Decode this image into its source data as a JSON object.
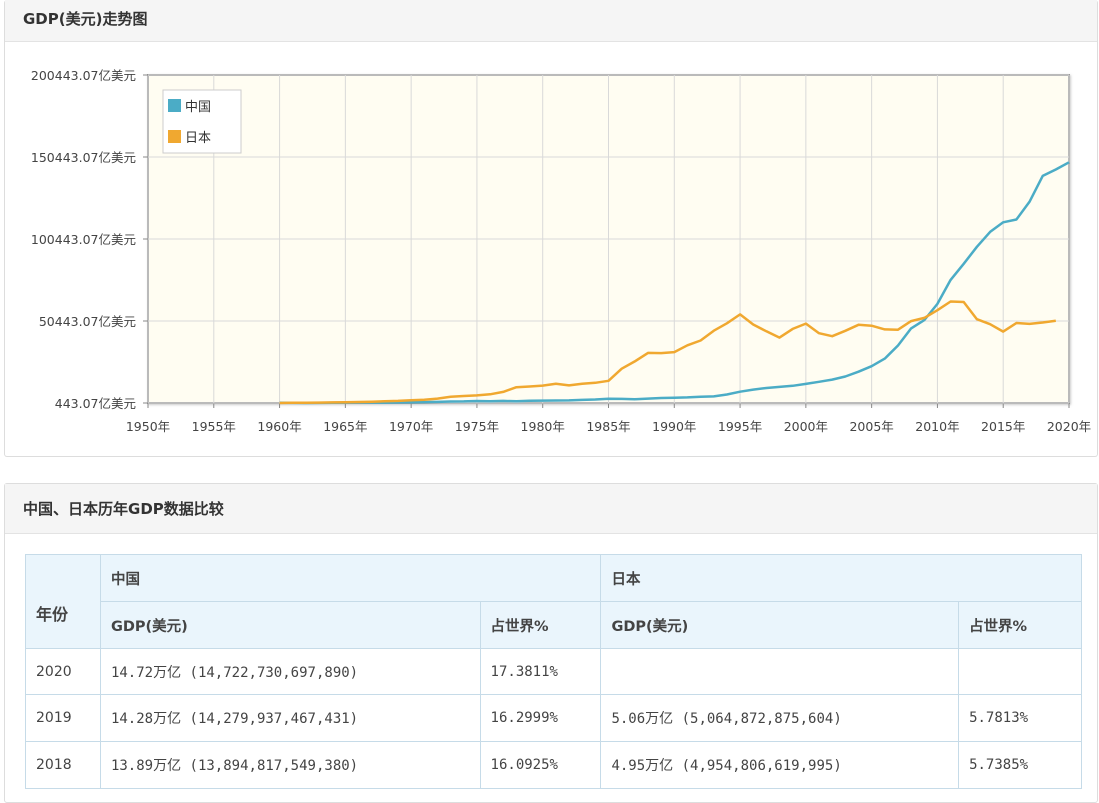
{
  "chart_panel": {
    "title": "GDP(美元)走势图"
  },
  "chart_data": {
    "type": "line",
    "title": "GDP(美元)走势图",
    "x_ticks": [
      "1950年",
      "1955年",
      "1960年",
      "1965年",
      "1970年",
      "1975年",
      "1980年",
      "1985年",
      "1990年",
      "1995年",
      "2000年",
      "2005年",
      "2010年",
      "2015年",
      "2020年"
    ],
    "y_ticks": [
      "443.07亿美元",
      "50443.07亿美元",
      "100443.07亿美元",
      "150443.07亿美元",
      "200443.07亿美元"
    ],
    "ylim": [
      443.07,
      200443.07
    ],
    "xlim": [
      1950,
      2020
    ],
    "grid": true,
    "legend_position": "top-left",
    "series": [
      {
        "name": "中国",
        "color": "#4bacc6",
        "x": [
          1960,
          1961,
          1962,
          1963,
          1964,
          1965,
          1966,
          1967,
          1968,
          1969,
          1970,
          1971,
          1972,
          1973,
          1974,
          1975,
          1976,
          1977,
          1978,
          1979,
          1980,
          1981,
          1982,
          1983,
          1984,
          1985,
          1986,
          1987,
          1988,
          1989,
          1990,
          1991,
          1992,
          1993,
          1994,
          1995,
          1996,
          1997,
          1998,
          1999,
          2000,
          2001,
          2002,
          2003,
          2004,
          2005,
          2006,
          2007,
          2008,
          2009,
          2010,
          2011,
          2012,
          2013,
          2014,
          2015,
          2016,
          2017,
          2018,
          2019,
          2020
        ],
        "values": [
          597,
          500,
          472,
          507,
          593,
          704,
          767,
          727,
          707,
          797,
          926,
          998,
          1137,
          1386,
          1442,
          1634,
          1539,
          1750,
          1495,
          1783,
          1911,
          1958,
          2050,
          2306,
          2599,
          3094,
          2970,
          2730,
          3123,
          3478,
          3609,
          3834,
          4269,
          4447,
          5643,
          7340,
          8637,
          9616,
          10290,
          10940,
          12110,
          13390,
          14710,
          16600,
          19550,
          22860,
          27530,
          35520,
          45940,
          51020,
          60870,
          75510,
          85320,
          95700,
          104750,
          110620,
          112330,
          123100,
          138948,
          142799,
          147227
        ]
      },
      {
        "name": "日本",
        "color": "#f0a830",
        "x": [
          1960,
          1961,
          1962,
          1963,
          1964,
          1965,
          1966,
          1967,
          1968,
          1969,
          1970,
          1971,
          1972,
          1973,
          1974,
          1975,
          1976,
          1977,
          1978,
          1979,
          1980,
          1981,
          1982,
          1983,
          1984,
          1985,
          1986,
          1987,
          1988,
          1989,
          1990,
          1991,
          1992,
          1993,
          1994,
          1995,
          1996,
          1997,
          1998,
          1999,
          2000,
          2001,
          2002,
          2003,
          2004,
          2005,
          2006,
          2007,
          2008,
          2009,
          2010,
          2011,
          2012,
          2013,
          2014,
          2015,
          2016,
          2017,
          2018,
          2019
        ],
        "values": [
          443,
          536,
          609,
          699,
          815,
          910,
          1050,
          1239,
          1467,
          1726,
          2127,
          2405,
          3137,
          4247,
          4681,
          5052,
          5777,
          7201,
          10060,
          10480,
          11060,
          12180,
          11160,
          12180,
          12730,
          14000,
          21350,
          25800,
          31000,
          30900,
          31450,
          35600,
          38530,
          44540,
          49070,
          54490,
          48330,
          44150,
          40320,
          45620,
          48880,
          43030,
          41160,
          44460,
          48150,
          47550,
          45300,
          45150,
          50370,
          52310,
          57000,
          62330,
          62030,
          51560,
          48500,
          43950,
          49230,
          48670,
          49548,
          50648
        ]
      }
    ]
  },
  "table_panel": {
    "title": "中国、日本历年GDP数据比较",
    "header": {
      "year": "年份",
      "china": "中国",
      "japan": "日本",
      "gdp": "GDP(美元)",
      "share": "占世界%"
    },
    "rows": [
      {
        "year": "2020",
        "cn_gdp": "14.72万亿 (14,722,730,697,890)",
        "cn_share": "17.3811%",
        "jp_gdp": "",
        "jp_share": ""
      },
      {
        "year": "2019",
        "cn_gdp": "14.28万亿 (14,279,937,467,431)",
        "cn_share": "16.2999%",
        "jp_gdp": "5.06万亿 (5,064,872,875,604)",
        "jp_share": "5.7813%"
      },
      {
        "year": "2018",
        "cn_gdp": "13.89万亿 (13,894,817,549,380)",
        "cn_share": "16.0925%",
        "jp_gdp": "4.95万亿 (4,954,806,619,995)",
        "jp_share": "5.7385%"
      }
    ]
  }
}
